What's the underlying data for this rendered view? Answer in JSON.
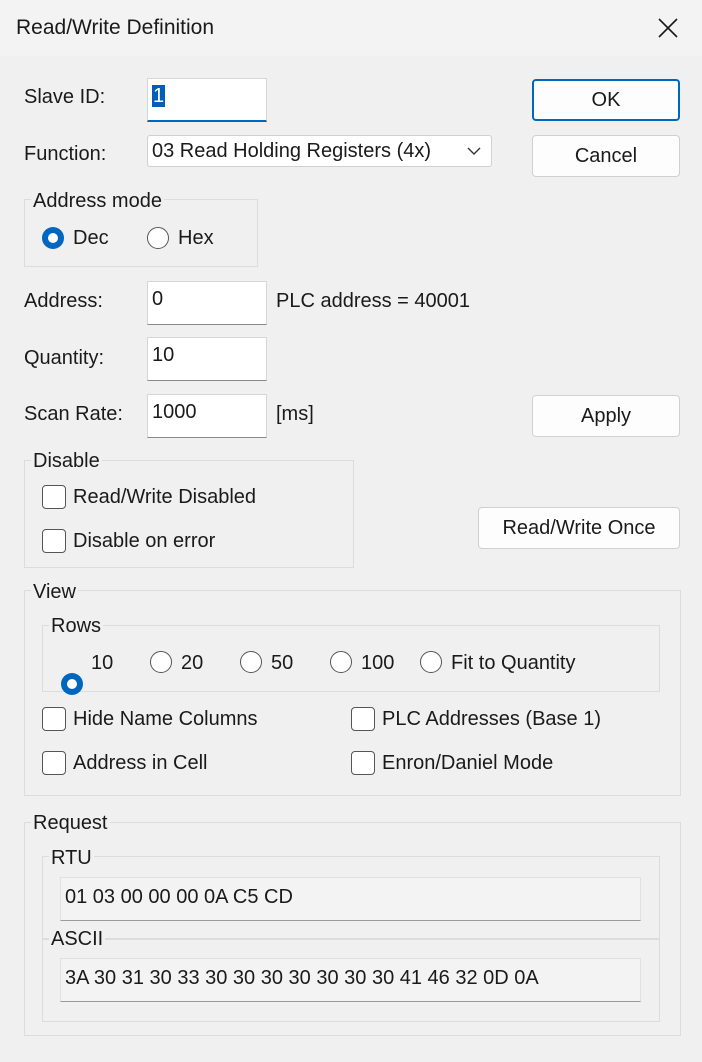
{
  "window": {
    "title": "Read/Write Definition",
    "close_icon": "close-icon"
  },
  "slave_id": {
    "label": "Slave ID:",
    "value": "1"
  },
  "function": {
    "label": "Function:",
    "value": "03 Read Holding Registers (4x)"
  },
  "address_mode": {
    "group_label": "Address mode",
    "options": [
      "Dec",
      "Hex"
    ],
    "selected": "Dec"
  },
  "address": {
    "label": "Address:",
    "value": "0",
    "plc_address_text": "PLC address = 40001"
  },
  "quantity": {
    "label": "Quantity:",
    "value": "10"
  },
  "scan_rate": {
    "label": "Scan Rate:",
    "value": "1000",
    "unit": "[ms]"
  },
  "buttons": {
    "ok": "OK",
    "cancel": "Cancel",
    "apply": "Apply",
    "read_write_once": "Read/Write Once"
  },
  "disable": {
    "group_label": "Disable",
    "read_write_disabled": "Read/Write Disabled",
    "disable_on_error": "Disable on error"
  },
  "view": {
    "group_label": "View",
    "rows": {
      "group_label": "Rows",
      "options": [
        "10",
        "20",
        "50",
        "100",
        "Fit to Quantity"
      ],
      "selected": "10"
    },
    "hide_name_columns": "Hide Name Columns",
    "plc_addresses_base1": "PLC Addresses (Base 1)",
    "address_in_cell": "Address in Cell",
    "enron_daniel_mode": "Enron/Daniel Mode"
  },
  "request": {
    "group_label": "Request",
    "rtu": {
      "label": "RTU",
      "value": "01 03 00 00 00 0A C5 CD"
    },
    "ascii": {
      "label": "ASCII",
      "value": "3A 30 31 30 33 30 30 30 30 30 30 30 41 46 32 0D 0A"
    }
  },
  "colors": {
    "accent": "#0067c0",
    "background": "#f0f0f0"
  }
}
